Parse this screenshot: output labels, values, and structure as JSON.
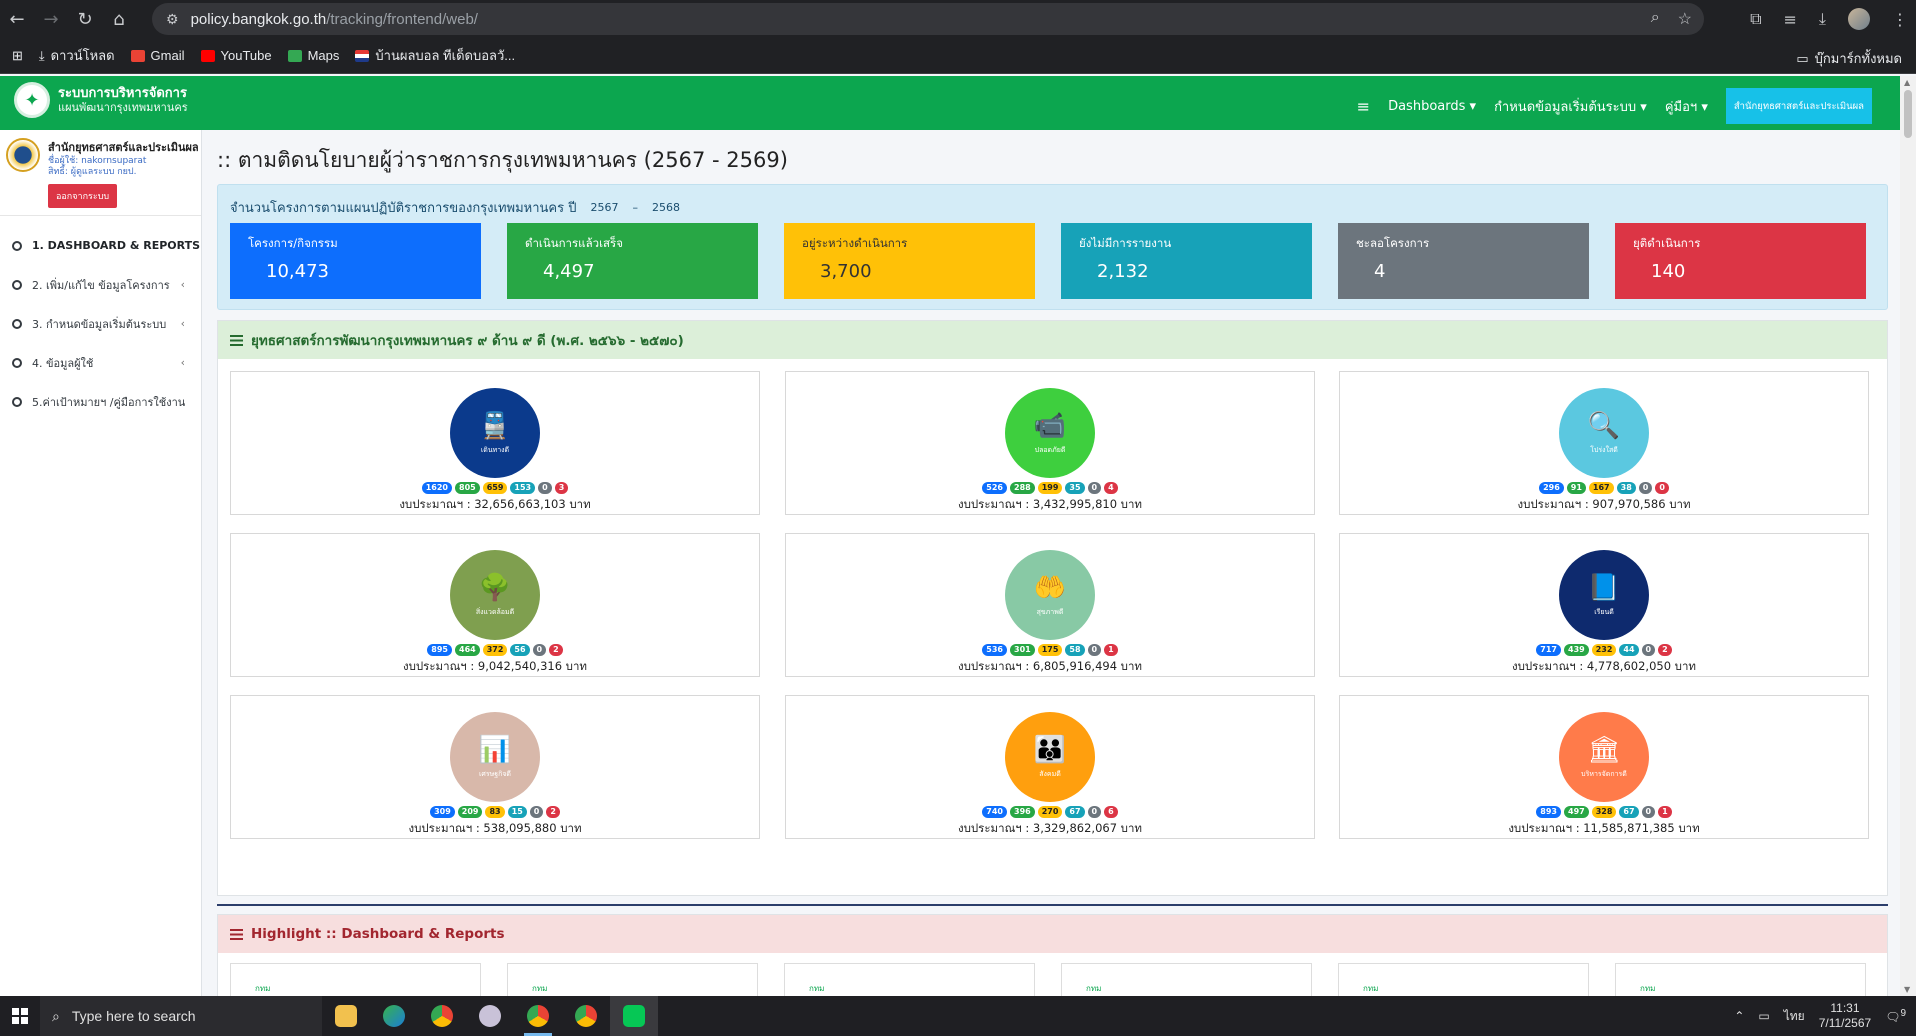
{
  "browser": {
    "url_host": "policy.bangkok.go.th",
    "url_path": "/tracking/frontend/web/",
    "bookmarks": [
      "ดาวน์โหลด",
      "Gmail",
      "YouTube",
      "Maps",
      "บ้านผลบอล ทีเด็ดบอลวั..."
    ],
    "all_bookmarks": "บุ๊กมาร์กทั้งหมด"
  },
  "header": {
    "brand_line1": "ระบบการบริหารจัดการ",
    "brand_line2": "แผนพัฒนากรุงเทพมหานคร",
    "nav": [
      "Dashboards",
      "กำหนดข้อมูลเริ่มต้นระบบ",
      "คู่มือฯ"
    ],
    "cta_label": "สำนักยุทธศาสตร์และประเมินผล"
  },
  "sidebar": {
    "org_name": "สำนักยุทธศาสตร์และประเมินผล",
    "username_line": "ชื่อผู้ใช้: nakornsuparat",
    "role_line": "สิทธิ์: ผู้ดูแลระบบ กยป.",
    "logout_label": "ออกจากระบบ",
    "items": [
      {
        "label": "1. DASHBOARD & REPORTS"
      },
      {
        "label": "2. เพิ่ม/แก้ไข ข้อมูลโครงการ"
      },
      {
        "label": "3. กำหนดข้อมูลเริ่มต้นระบบ"
      },
      {
        "label": "4. ข้อมูลผู้ใช้"
      },
      {
        "label": "5.ค่าเป้าหมายฯ /คู่มือการใช้งาน"
      }
    ]
  },
  "main": {
    "title": ":: ตามติดนโยบายผู้ว่าราชการกรุงเทพมหานคร (2567 - 2569)",
    "stats_heading": "จำนวนโครงการตามแผนปฏิบัติราชการของกรุงเทพมหานคร ปี",
    "year_from": "2567",
    "year_sep": "–",
    "year_to": "2568",
    "stats": [
      {
        "label": "โครงการ/กิจกรรม",
        "value": "10,473",
        "color": "#0d6efd"
      },
      {
        "label": "ดำเนินการแล้วเสร็จ",
        "value": "4,497",
        "color": "#28a745"
      },
      {
        "label": "อยู่ระหว่างดำเนินการ",
        "value": "3,700",
        "color": "#ffc107"
      },
      {
        "label": "ยังไม่มีการรายงาน",
        "value": "2,132",
        "color": "#17a2b8"
      },
      {
        "label": "ชะลอโครงการ",
        "value": "4",
        "color": "#6c757d"
      },
      {
        "label": "ยุติดำเนินการ",
        "value": "140",
        "color": "#dc3545"
      }
    ],
    "strategy_heading": "ยุทธศาสตร์การพัฒนากรุงเทพมหานคร ๙ ด้าน ๙ ดี (พ.ศ. ๒๕๖๖ - ๒๕๗๐)",
    "strategies": [
      {
        "caption": "เดินทางดี",
        "icon": "train-icon",
        "glyph": "🚆",
        "color": "#0b3a8c",
        "badges": [
          "1620",
          "805",
          "659",
          "153",
          "0",
          "3"
        ],
        "budget": "งบประมาณฯ : 32,656,663,103 บาท"
      },
      {
        "caption": "ปลอดภัยดี",
        "icon": "cctv-icon",
        "glyph": "📹",
        "color": "#3ecf3e",
        "badges": [
          "526",
          "288",
          "199",
          "35",
          "0",
          "4"
        ],
        "budget": "งบประมาณฯ : 3,432,995,810 บาท"
      },
      {
        "caption": "โปร่งใสดี",
        "icon": "magnifier-icon",
        "glyph": "🔍",
        "color": "#5bc8e0",
        "badges": [
          "296",
          "91",
          "167",
          "38",
          "0",
          "0"
        ],
        "budget": "งบประมาณฯ : 907,970,586 บาท"
      },
      {
        "caption": "สิ่งแวดล้อมดี",
        "icon": "tree-icon",
        "glyph": "🌳",
        "color": "#7f9f4f",
        "badges": [
          "895",
          "464",
          "372",
          "56",
          "0",
          "2"
        ],
        "budget": "งบประมาณฯ : 9,042,540,316 บาท"
      },
      {
        "caption": "สุขภาพดี",
        "icon": "health-hand-icon",
        "glyph": "🤲",
        "color": "#88c9a5",
        "badges": [
          "536",
          "301",
          "175",
          "58",
          "0",
          "1"
        ],
        "budget": "งบประมาณฯ : 6,805,916,494 บาท"
      },
      {
        "caption": "เรียนดี",
        "icon": "book-icon",
        "glyph": "📘",
        "color": "#0e2a6e",
        "badges": [
          "717",
          "439",
          "232",
          "44",
          "0",
          "2"
        ],
        "budget": "งบประมาณฯ : 4,778,602,050 บาท"
      },
      {
        "caption": "เศรษฐกิจดี",
        "icon": "bar-chart-icon",
        "glyph": "📊",
        "color": "#d8b8aa",
        "badges": [
          "309",
          "209",
          "83",
          "15",
          "0",
          "2"
        ],
        "budget": "งบประมาณฯ : 538,095,880 บาท"
      },
      {
        "caption": "สังคมดี",
        "icon": "people-icon",
        "glyph": "👪",
        "color": "#ff9f0e",
        "badges": [
          "740",
          "396",
          "270",
          "67",
          "0",
          "6"
        ],
        "budget": "งบประมาณฯ : 3,329,862,067 บาท"
      },
      {
        "caption": "บริหารจัดการดี",
        "icon": "org-chart-icon",
        "glyph": "🏛",
        "color": "#ff7b4a",
        "badges": [
          "893",
          "497",
          "328",
          "67",
          "0",
          "1"
        ],
        "budget": "งบประมาณฯ : 11,585,871,385 บาท"
      }
    ],
    "highlight_heading": "Highlight :: Dashboard & Reports",
    "mini_label": "กทม"
  },
  "taskbar": {
    "search_placeholder": "Type here to search",
    "lang": "ไทย",
    "time": "11:31",
    "date": "7/11/2567",
    "notif": "9"
  }
}
